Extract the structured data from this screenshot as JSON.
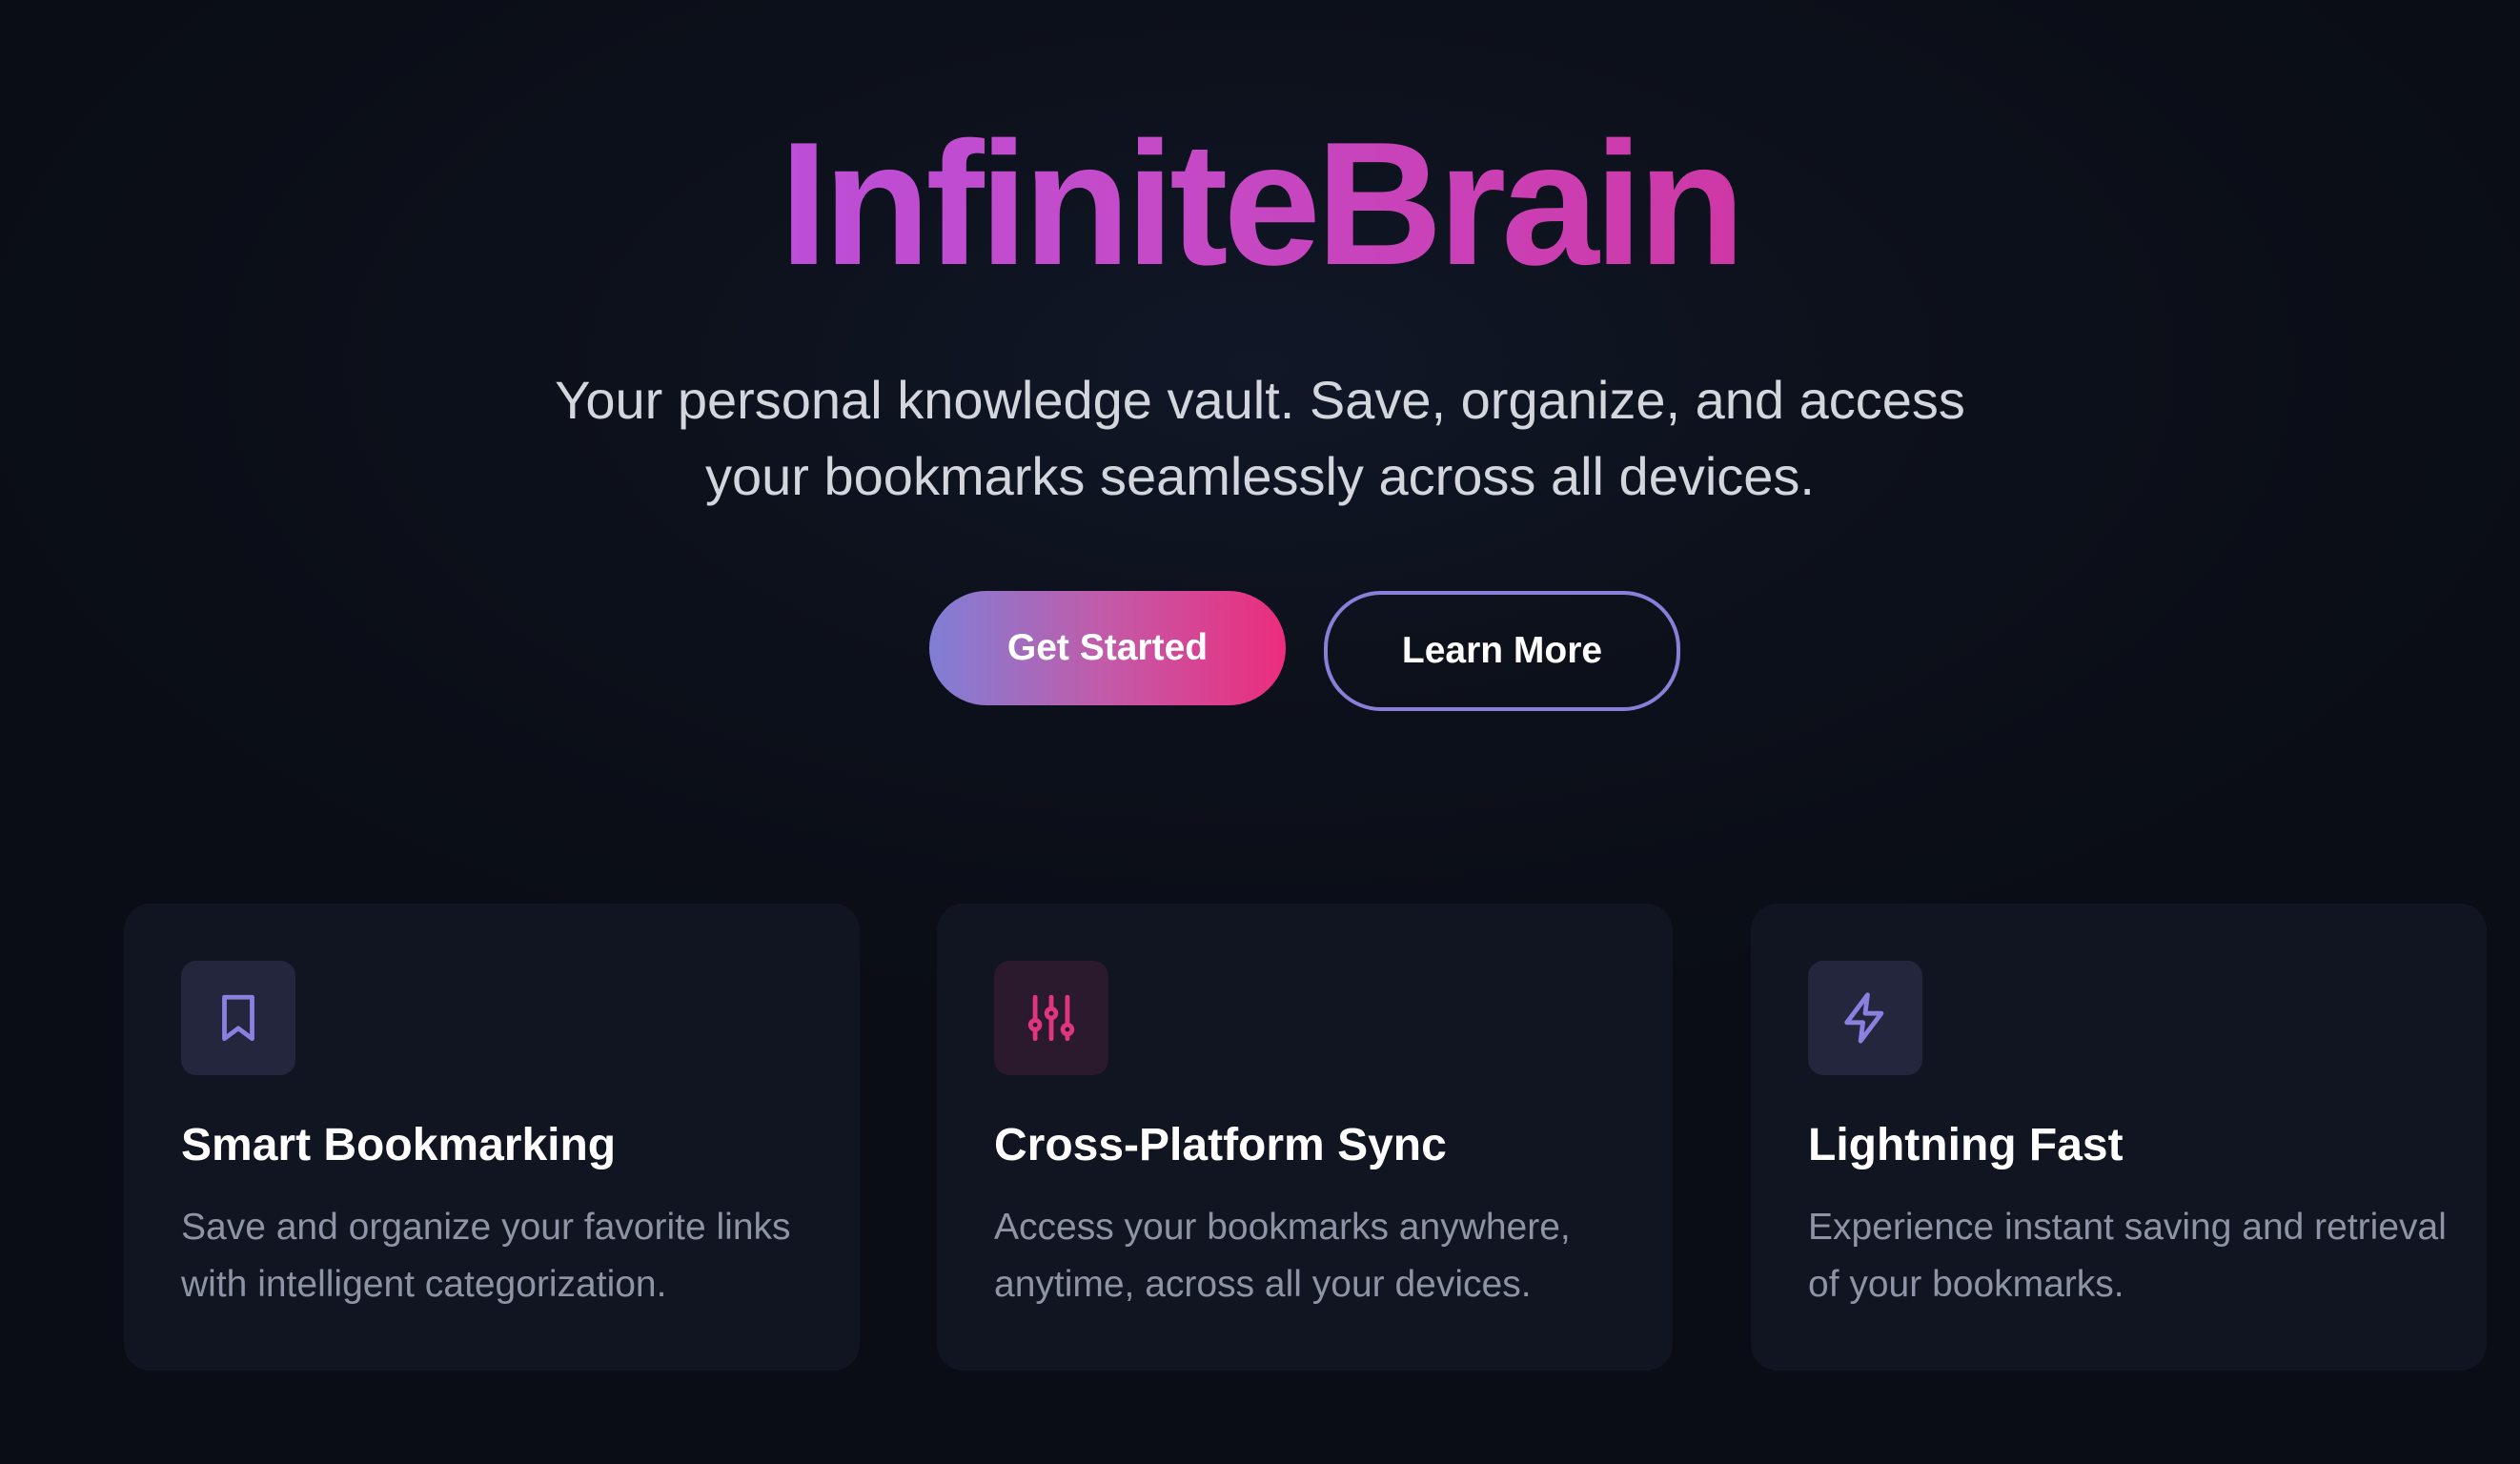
{
  "brand": {
    "name": "InfiniteBrain"
  },
  "hero": {
    "tagline": "Your personal knowledge vault. Save, organize, and access your bookmarks seamlessly across all devices.",
    "primary_button": "Get Started",
    "secondary_button": "Learn More"
  },
  "colors": {
    "brand_gradient_start": "#a855f7",
    "brand_gradient_end": "#db1f78",
    "background": "#0b0e17",
    "card_background": "#111521"
  },
  "features": [
    {
      "icon": "bookmark-icon",
      "title": "Smart Bookmarking",
      "description": "Save and organize your favorite links with intelligent categorization."
    },
    {
      "icon": "sliders-icon",
      "title": "Cross-Platform Sync",
      "description": "Access your bookmarks anywhere, anytime, across all your devices."
    },
    {
      "icon": "lightning-icon",
      "title": "Lightning Fast",
      "description": "Experience instant saving and retrieval of your bookmarks."
    }
  ]
}
